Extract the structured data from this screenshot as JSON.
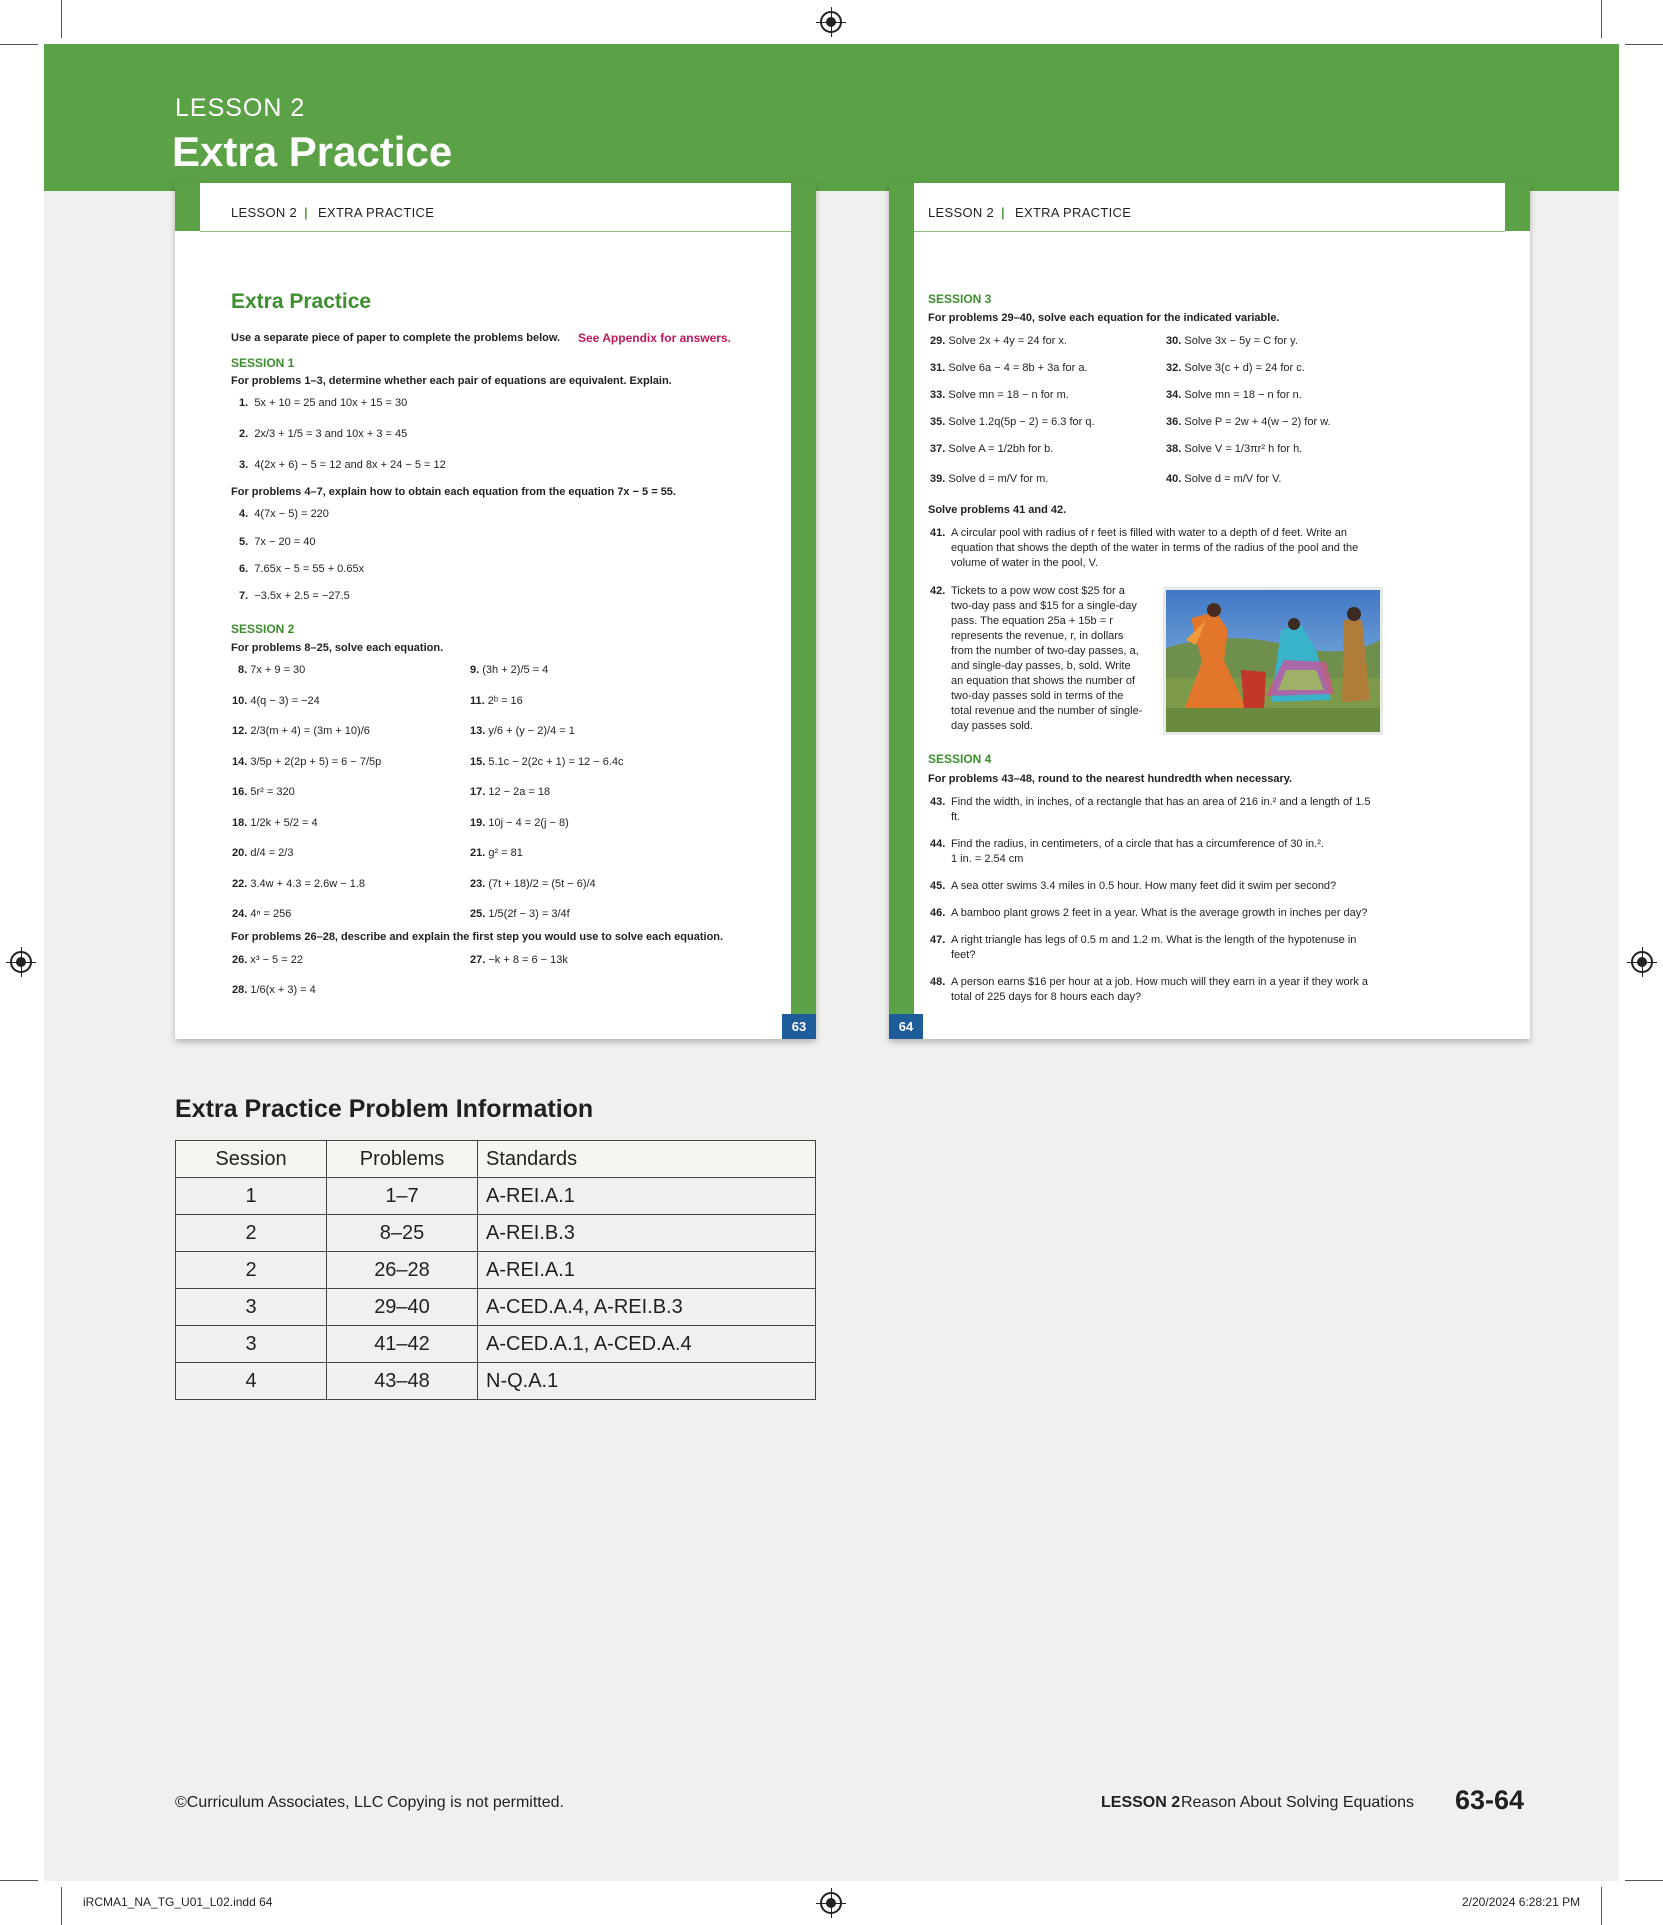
{
  "banner": {
    "kicker": "LESSON 2",
    "title": "Extra Practice"
  },
  "left_page": {
    "header": {
      "lesson": "LESSON 2",
      "sep": "|",
      "section": "EXTRA PRACTICE"
    },
    "title": "Extra Practice",
    "intro": "Use a separate piece of paper to complete the problems below.",
    "appendix": "See Appendix for answers.",
    "session1": {
      "label": "SESSION 1",
      "instr1": "For problems 1–3, determine whether each pair of equations are equivalent. Explain.",
      "p1": "5x + 10 = 25 and 10x + 15 = 30",
      "p2": "2x/3 + 1/5 = 3 and 10x + 3 = 45",
      "p3": "4(2x + 6) − 5 = 12 and 8x + 24 − 5 = 12",
      "instr2": "For problems 4–7, explain how to obtain each equation from the equation 7x − 5 = 55.",
      "p4": "4(7x − 5) = 220",
      "p5": "7x − 20 = 40",
      "p6": "7.65x − 5 = 55 + 0.65x",
      "p7": "−3.5x + 2.5 = −27.5"
    },
    "session2": {
      "label": "SESSION 2",
      "instr": "For problems 8–25, solve each equation.",
      "problems": [
        {
          "n": "8.",
          "eq": "7x + 9 = 30"
        },
        {
          "n": "9.",
          "eq": "(3h + 2)/5 = 4"
        },
        {
          "n": "10.",
          "eq": "4(q − 3) = −24"
        },
        {
          "n": "11.",
          "eq": "2ᵇ = 16"
        },
        {
          "n": "12.",
          "eq": "2/3(m + 4) = (3m + 10)/6"
        },
        {
          "n": "13.",
          "eq": "y/6 + (y − 2)/4 = 1"
        },
        {
          "n": "14.",
          "eq": "3/5p + 2(2p + 5) = 6 − 7/5p"
        },
        {
          "n": "15.",
          "eq": "5.1c − 2(2c + 1) = 12 − 6.4c"
        },
        {
          "n": "16.",
          "eq": "5r² = 320"
        },
        {
          "n": "17.",
          "eq": "12 − 2a = 18"
        },
        {
          "n": "18.",
          "eq": "1/2k + 5/2 = 4"
        },
        {
          "n": "19.",
          "eq": "10j − 4 = 2(j − 8)"
        },
        {
          "n": "20.",
          "eq": "d/4 = 2/3"
        },
        {
          "n": "21.",
          "eq": "g² = 81"
        },
        {
          "n": "22.",
          "eq": "3.4w + 4.3 = 2.6w − 1.8"
        },
        {
          "n": "23.",
          "eq": "(7t + 18)/2 = (5t − 6)/4"
        },
        {
          "n": "24.",
          "eq": "4ⁿ = 256"
        },
        {
          "n": "25.",
          "eq": "1/5(2f − 3) = 3/4f"
        }
      ],
      "instr2": "For problems 26–28, describe and explain the first step you would use to solve each equation.",
      "p26": "x³ − 5 = 22",
      "p27": "−k + 8 = 6 − 13k",
      "p28": "1/6(x + 3) = 4"
    },
    "page_number": "63"
  },
  "right_page": {
    "header": {
      "lesson": "LESSON 2",
      "sep": "|",
      "section": "EXTRA PRACTICE"
    },
    "session3": {
      "label": "SESSION 3",
      "instr": "For problems 29–40, solve each equation for the indicated variable.",
      "problems": [
        {
          "n": "29.",
          "eq": "Solve 2x + 4y = 24 for x."
        },
        {
          "n": "30.",
          "eq": "Solve 3x − 5y = C for y."
        },
        {
          "n": "31.",
          "eq": "Solve 6a − 4 = 8b + 3a for a."
        },
        {
          "n": "32.",
          "eq": "Solve 3(c + d) = 24 for c."
        },
        {
          "n": "33.",
          "eq": "Solve mn = 18 − n for m."
        },
        {
          "n": "34.",
          "eq": "Solve mn = 18 − n for n."
        },
        {
          "n": "35.",
          "eq": "Solve 1.2q(5p − 2) = 6.3 for q."
        },
        {
          "n": "36.",
          "eq": "Solve P = 2w + 4(w − 2) for w."
        },
        {
          "n": "37.",
          "eq": "Solve A = 1/2bh for b."
        },
        {
          "n": "38.",
          "eq": "Solve V = 1/3πr² h for h."
        },
        {
          "n": "39.",
          "eq": "Solve d = m/V for m."
        },
        {
          "n": "40.",
          "eq": "Solve d = m/V for V."
        }
      ],
      "instr2": "Solve problems 41 and 42.",
      "p41": "A circular pool with radius of r feet is filled with water to a depth of d feet. Write an equation that shows the depth of the water in terms of the radius of the pool and the volume of water in the pool, V.",
      "p42": "Tickets to a pow wow cost $25 for a two-day pass and $15 for a single-day pass. The equation 25a + 15b = r represents the revenue, r, in dollars from the number of two-day passes, a, and single-day passes, b, sold. Write an equation that shows the number of two-day passes sold in terms of the total revenue and the number of single-day passes sold."
    },
    "session4": {
      "label": "SESSION 4",
      "instr": "For problems 43–48, round to the nearest hundredth when necessary.",
      "p43": "Find the width, in inches, of a rectangle that has an area of 216 in.² and a length of 1.5 ft.",
      "p44a": "Find the radius, in centimeters, of a circle that has a circumference of 30 in.².",
      "p44b": "1 in. = 2.54 cm",
      "p45": "A sea otter swims 3.4 miles in 0.5 hour. How many feet did it swim per second?",
      "p46": "A bamboo plant grows 2 feet in a year. What is the average growth in inches per day?",
      "p47": "A right triangle has legs of 0.5 m and 1.2 m. What is the length of the hypotenuse in feet?",
      "p48": "A person earns $16 per hour at a job. How much will they earn in a year if they work a total of 225 days for 8 hours each day?"
    },
    "page_number": "64"
  },
  "table": {
    "title": "Extra Practice Problem Information",
    "headers": [
      "Session",
      "Problems",
      "Standards"
    ],
    "rows": [
      [
        "1",
        "1–7",
        "A-REI.A.1"
      ],
      [
        "2",
        "8–25",
        "A-REI.B.3"
      ],
      [
        "2",
        "26–28",
        "A-REI.A.1"
      ],
      [
        "3",
        "29–40",
        "A-CED.A.4, A-REI.B.3"
      ],
      [
        "3",
        "41–42",
        "A-CED.A.1, A-CED.A.4"
      ],
      [
        "4",
        "43–48",
        "N-Q.A.1"
      ]
    ]
  },
  "footer": {
    "copyright": "©Curriculum Associates, LLC",
    "copying": "Copying is not permitted.",
    "lesson": "LESSON 2",
    "lesson_title": "Reason About Solving Equations",
    "pages": "63-64"
  },
  "slug": {
    "file": "iRCMA1_NA_TG_U01_L02.indd   64",
    "timestamp": "2/20/2024   6:28:21 PM"
  }
}
